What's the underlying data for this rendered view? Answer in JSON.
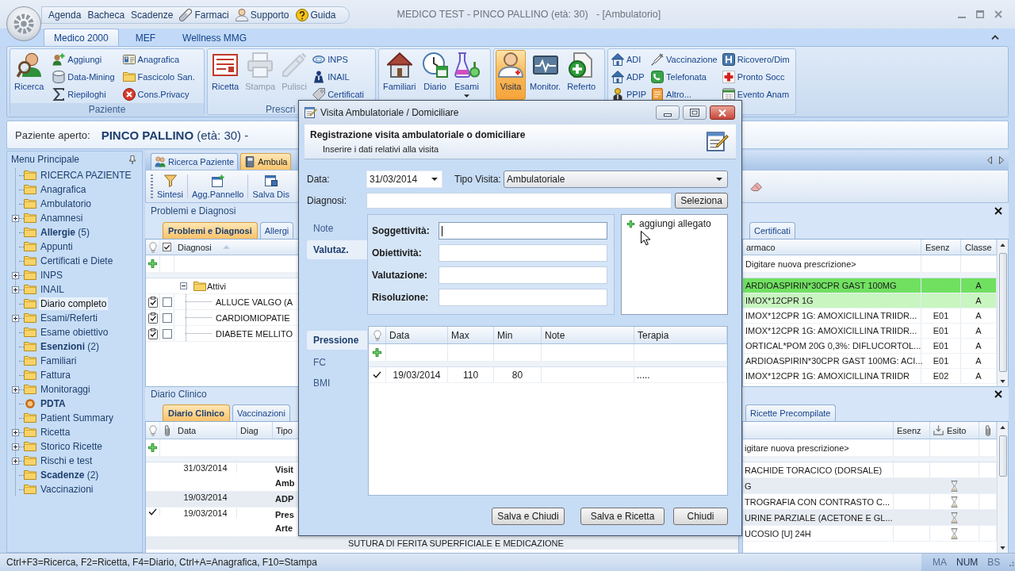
{
  "window": {
    "title": "MEDICO TEST - PINCO PALLINO (età: 30)   - [Ambulatorio]",
    "quick_access": [
      {
        "label": "Agenda",
        "kind": "text"
      },
      {
        "label": "Bacheca",
        "kind": "text"
      },
      {
        "label": "Scadenze",
        "kind": "text"
      },
      {
        "label": "Farmaci",
        "kind": "icon"
      },
      {
        "label": "Supporto",
        "kind": "icon"
      },
      {
        "label": "Guida",
        "kind": "icon"
      }
    ],
    "tabs": [
      {
        "label": "Medico 2000",
        "selected": true
      },
      {
        "label": "MEF",
        "selected": false
      },
      {
        "label": "Wellness MMG",
        "selected": false
      }
    ]
  },
  "ribbon": {
    "groups": [
      {
        "label": "Paziente",
        "large": [
          {
            "label": "Ricerca",
            "disabled": false,
            "active": false,
            "dropdown": false
          }
        ],
        "columns": [
          [
            "Aggiungi",
            "Data-Mining",
            "Riepiloghi"
          ],
          [
            "Anagrafica",
            "Fascicolo San.",
            "Cons.Privacy"
          ]
        ]
      },
      {
        "label": "Prescri",
        "large": [
          {
            "label": "Ricetta",
            "disabled": false,
            "active": false,
            "dropdown": false
          },
          {
            "label": "Stampa",
            "disabled": true,
            "active": false,
            "dropdown": false
          },
          {
            "label": "Pulisci",
            "disabled": true,
            "active": false,
            "dropdown": false
          }
        ],
        "columns": [
          [
            "INPS",
            "INAIL",
            "Certificati"
          ]
        ]
      },
      {
        "large": [
          {
            "label": "Familiari",
            "disabled": false,
            "active": false,
            "dropdown": false
          },
          {
            "label": "Diario",
            "disabled": false,
            "active": false,
            "dropdown": false
          },
          {
            "label": "Esami",
            "disabled": false,
            "active": false,
            "dropdown": true
          }
        ]
      },
      {
        "large": [
          {
            "label": "Visita",
            "disabled": false,
            "active": true,
            "dropdown": false
          },
          {
            "label": "Monitor.",
            "disabled": false,
            "active": false,
            "dropdown": false
          },
          {
            "label": "Referto",
            "disabled": false,
            "active": false,
            "dropdown": false
          }
        ]
      },
      {
        "columns": [
          [
            "ADI",
            "ADP",
            "PPIP"
          ],
          [
            "Vaccinazione",
            "Telefonata",
            "Altro..."
          ],
          [
            "Ricovero/Dim",
            "Pronto Socc",
            "Evento Anam"
          ]
        ]
      }
    ]
  },
  "patient": {
    "label": "Paziente aperto:",
    "name": "**PINCO PALLINO** (età: 30) -"
  },
  "sidebar": {
    "title": "Menu Principale",
    "items": [
      {
        "label": "RICERCA PAZIENTE",
        "kind": "folder",
        "expandable": false,
        "bold": false,
        "selected": false
      },
      {
        "label": "Anagrafica",
        "kind": "folder",
        "expandable": false,
        "bold": false,
        "selected": false
      },
      {
        "label": "Ambulatorio",
        "kind": "folder",
        "expandable": false,
        "bold": false,
        "selected": false
      },
      {
        "label": "Anamnesi",
        "kind": "folder",
        "expandable": true,
        "bold": false,
        "selected": false
      },
      {
        "label": "**Allergie** (5)",
        "kind": "folder",
        "expandable": false,
        "bold": false,
        "selected": false
      },
      {
        "label": "Appunti",
        "kind": "folder",
        "expandable": false,
        "bold": false,
        "selected": false
      },
      {
        "label": "Certificati e Diete",
        "kind": "folder",
        "expandable": false,
        "bold": false,
        "selected": false
      },
      {
        "label": "INPS",
        "kind": "folder",
        "expandable": true,
        "bold": false,
        "selected": false
      },
      {
        "label": "INAIL",
        "kind": "folder",
        "expandable": true,
        "bold": false,
        "selected": false
      },
      {
        "label": "Diario completo",
        "kind": "folder",
        "expandable": false,
        "bold": false,
        "selected": true
      },
      {
        "label": "Esami/Referti",
        "kind": "folder",
        "expandable": true,
        "bold": false,
        "selected": false
      },
      {
        "label": "Esame obiettivo",
        "kind": "folder",
        "expandable": false,
        "bold": false,
        "selected": false
      },
      {
        "label": "**Esenzioni** (2)",
        "kind": "folder",
        "expandable": false,
        "bold": false,
        "selected": false
      },
      {
        "label": "Familiari",
        "kind": "folder",
        "expandable": false,
        "bold": false,
        "selected": false
      },
      {
        "label": "Fattura",
        "kind": "folder",
        "expandable": false,
        "bold": false,
        "selected": false
      },
      {
        "label": "Monitoraggi",
        "kind": "folder",
        "expandable": true,
        "bold": false,
        "selected": false
      },
      {
        "label": "PDTA",
        "kind": "circle",
        "expandable": false,
        "bold": true,
        "selected": false
      },
      {
        "label": "Patient Summary",
        "kind": "folder",
        "expandable": false,
        "bold": false,
        "selected": false
      },
      {
        "label": "Ricetta",
        "kind": "folder",
        "expandable": true,
        "bold": false,
        "selected": false
      },
      {
        "label": "Storico Ricette",
        "kind": "folder",
        "expandable": true,
        "bold": false,
        "selected": false
      },
      {
        "label": "Rischi e test",
        "kind": "folder",
        "expandable": true,
        "bold": false,
        "selected": false
      },
      {
        "label": "**Scadenze** (2)",
        "kind": "folder",
        "expandable": false,
        "bold": false,
        "selected": false
      },
      {
        "label": "Vaccinazioni",
        "kind": "folder",
        "expandable": false,
        "bold": false,
        "selected": false
      }
    ]
  },
  "doc_tabs": [
    {
      "label": "Ricerca Paziente",
      "selected": false
    },
    {
      "label": "Ambula",
      "selected": true
    }
  ],
  "toolbar": [
    "Sintesi",
    "Agg.Pannello",
    "Salva Dis"
  ],
  "problems": {
    "title": "Problemi e Diagnosi",
    "tabs": [
      {
        "label": "Problemi e Diagnosi",
        "selected": true
      },
      {
        "label": "Allergi",
        "selected": false
      }
    ],
    "column": "Diagnosi",
    "group": {
      "label": "Attivi",
      "expanded": true
    },
    "rows": [
      {
        "text": "ALLUCE VALGO (A",
        "checked": false
      },
      {
        "text": "CARDIOMIOPATIE",
        "checked": false
      },
      {
        "text": "DIABETE MELLITO",
        "checked": false
      }
    ]
  },
  "diary": {
    "title": "Diario Clinico",
    "tabs": [
      {
        "label": "Diario Clinico",
        "selected": true
      },
      {
        "label": "Vaccinazioni",
        "selected": false
      }
    ],
    "columns": [
      "Data",
      "Diag",
      "Tipo"
    ],
    "rows": [
      {
        "date": "31/03/2014",
        "type": [
          "Visit",
          "Amb"
        ],
        "done": false
      },
      {
        "date": "19/03/2014",
        "type": [
          "ADP"
        ],
        "done": false
      },
      {
        "date": "19/03/2014",
        "type": [
          "Pres",
          "Arte"
        ],
        "done": true
      },
      {
        "description": "SUTURA DI FERITA SUPERFICIALE E MEDICAZIONE",
        "done": false
      }
    ]
  },
  "prescriptions": {
    "tabs": [
      {
        "label": "Certificati",
        "selected": false
      }
    ],
    "columns": [
      "armaco",
      "Esenz",
      "Classe"
    ],
    "new_row": "Digitare nuova prescrizione>",
    "rows": [
      {
        "drug": "ARDIOASPIRIN*30CPR GAST 100MG",
        "classe": "A",
        "color": "#70e060"
      },
      {
        "drug": "IMOX*12CPR 1G",
        "classe": "A",
        "color": "#c8f5c0"
      },
      {
        "drug": "IMOX*12CPR 1G: AMOXICILLINA TRIIDR...",
        "esenz": "E01",
        "classe": "A",
        "color": "#ffffff"
      },
      {
        "drug": "IMOX*12CPR 1G: AMOXICILLINA TRIIDR...",
        "esenz": "E01",
        "classe": "A",
        "color": "#ffffff"
      },
      {
        "drug": "ORTICAL*POM 20G 0,3%: DIFLUCORTOL...",
        "esenz": "E01",
        "classe": "A",
        "color": "#ffffff"
      },
      {
        "drug": "ARDIOASPIRIN*30CPR GAST 100MG: ACI...",
        "esenz": "E01",
        "classe": "A",
        "color": "#ffffff"
      },
      {
        "drug": "IMOX*12CPR 1G: AMOXICILLINA TRIIDR",
        "esenz": "E02",
        "classe": "A",
        "color": "#ffffff"
      }
    ]
  },
  "requests": {
    "tabs": [
      {
        "label": "Ricette Precompilate",
        "selected": false
      }
    ],
    "columns": [
      "Esenz",
      "Esito"
    ],
    "new_row": "igitare nuova prescrizione>",
    "rows": [
      {
        "text": "RACHIDE TORACICO (DORSALE)",
        "pending": false
      },
      {
        "text": "G",
        "pending": true
      },
      {
        "text": "TROGRAFIA CON CONTRASTO C...",
        "pending": true
      },
      {
        "text": "URINE PARZIALE (ACETONE E GL...",
        "pending": true
      },
      {
        "text": "UCOSIO [U] 24H",
        "pending": true
      }
    ]
  },
  "dialog": {
    "title": "Visita Ambulatoriale / Domiciliare",
    "heading": "Registrazione visita ambulatoriale o domiciliare",
    "subheading": "Inserire i dati relativi alla visita",
    "date_label": "Data:",
    "date_value": "31/03/2014",
    "type_label": "Tipo Visita:",
    "type_value": "Ambulatoriale",
    "diagnosis_label": "Diagnosi:",
    "select_button": "Seleziona",
    "note_tabs": [
      {
        "label": "Note",
        "selected": false
      },
      {
        "label": "Valutaz.",
        "selected": true
      }
    ],
    "soap_fields": [
      {
        "label": "Soggettività:",
        "focused": true
      },
      {
        "label": "Obiettività:",
        "focused": false
      },
      {
        "label": "Valutazione:",
        "focused": false
      },
      {
        "label": "Risoluzione:",
        "focused": false
      }
    ],
    "attach_link": "aggiungi allegato",
    "measure_tabs": [
      {
        "label": "Pressione",
        "selected": true
      },
      {
        "label": "FC",
        "selected": false
      },
      {
        "label": "BMI",
        "selected": false
      }
    ],
    "table": {
      "columns": [
        "Data",
        "Max",
        "Min",
        "Note",
        "Terapia"
      ],
      "rows": [
        {
          "checked": true,
          "date": "19/03/2014",
          "max": "110",
          "min": "80",
          "therapy": "....."
        }
      ]
    },
    "buttons": [
      "Salva e Chiudi",
      "Salva e Ricetta",
      "Chiudi"
    ]
  },
  "status_bar": {
    "hint": "Ctrl+F3=Ricerca, F2=Ricetta, F4=Diario, Ctrl+A=Anagrafica, F10=Stampa",
    "indicators": [
      {
        "label": "MA",
        "on": false
      },
      {
        "label": "NUM",
        "on": true
      },
      {
        "label": "BS",
        "on": false
      }
    ]
  }
}
